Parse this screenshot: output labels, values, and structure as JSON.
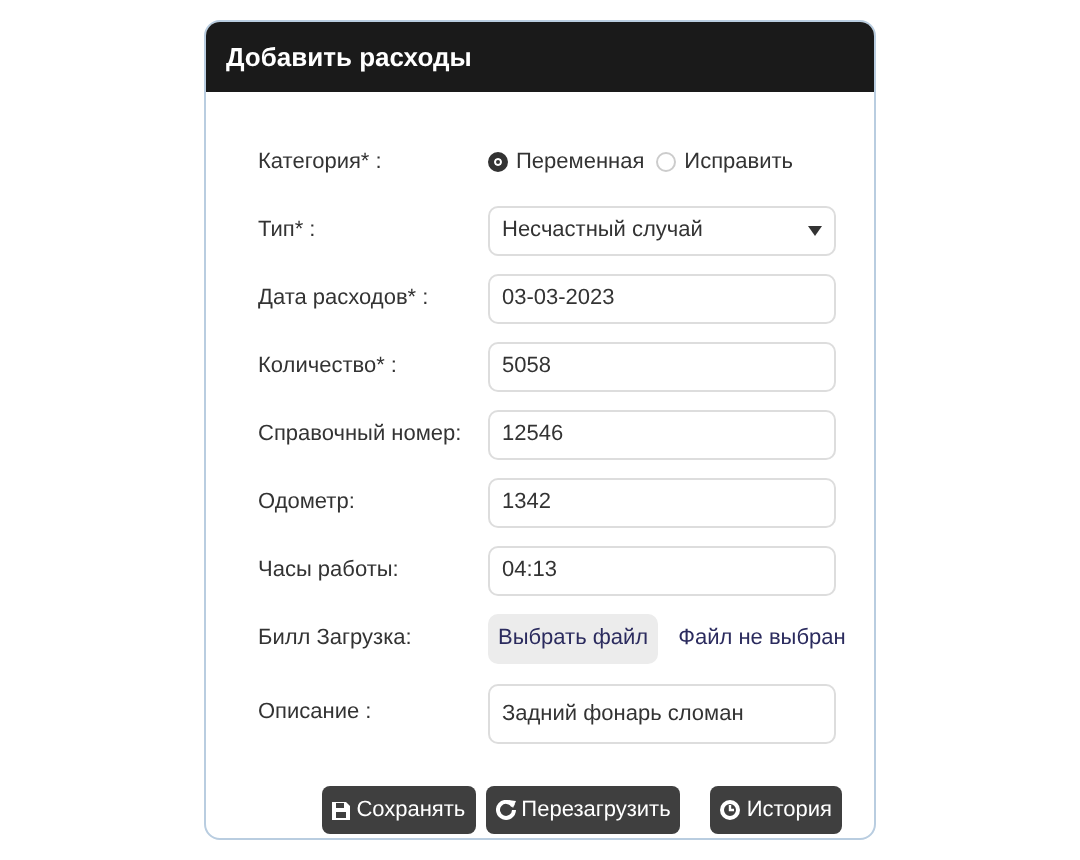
{
  "card": {
    "title": "Добавить расходы"
  },
  "fields": [
    {
      "kind": "radio",
      "label": "Категория* :",
      "options": [
        {
          "label": "Переменная",
          "selected": true
        },
        {
          "label": "Исправить",
          "selected": false
        }
      ]
    },
    {
      "kind": "select",
      "label": "Тип* :",
      "value": "Несчастный случай"
    },
    {
      "kind": "text",
      "label": "Дата расходов* :",
      "value": "03-03-2023"
    },
    {
      "kind": "text",
      "label": "Количество* :",
      "value": "5058"
    },
    {
      "kind": "text",
      "label": "Справочный номер:",
      "value": "12546"
    },
    {
      "kind": "text",
      "label": "Одометр:",
      "value": "1342"
    },
    {
      "kind": "text",
      "label": "Часы работы:",
      "value": "04:13"
    },
    {
      "kind": "file",
      "label": "Билл Загрузка:",
      "button": "Выбрать файл",
      "status": "Файл не выбран"
    },
    {
      "kind": "text",
      "label": "Описание :",
      "value": "Задний фонарь сломан"
    }
  ],
  "buttons": [
    {
      "kind": "save",
      "label": "Сохранять"
    },
    {
      "kind": "reload",
      "label": "Перезагрузить"
    },
    {
      "kind": "history",
      "label": "История"
    }
  ]
}
